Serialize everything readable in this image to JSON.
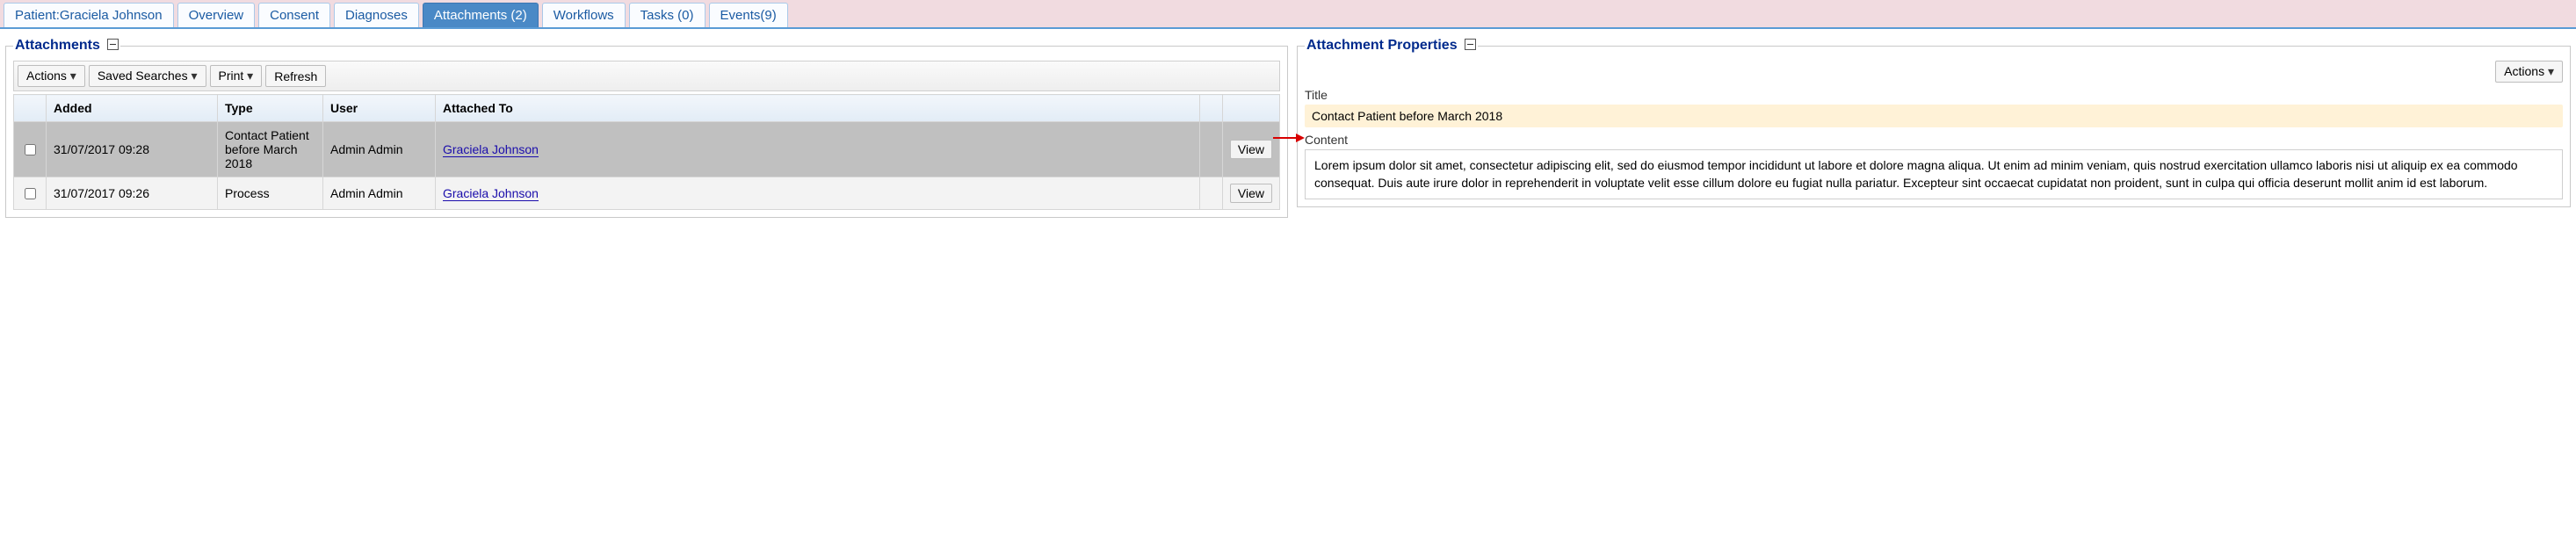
{
  "tabs": [
    {
      "label": "Patient:Graciela Johnson",
      "active": false
    },
    {
      "label": "Overview",
      "active": false
    },
    {
      "label": "Consent",
      "active": false
    },
    {
      "label": "Diagnoses",
      "active": false
    },
    {
      "label": "Attachments (2)",
      "active": true
    },
    {
      "label": "Workflows",
      "active": false
    },
    {
      "label": "Tasks (0)",
      "active": false
    },
    {
      "label": "Events(9)",
      "active": false
    }
  ],
  "attachments_panel": {
    "legend": "Attachments",
    "toolbar": {
      "actions": "Actions",
      "saved_searches": "Saved Searches",
      "print": "Print",
      "refresh": "Refresh"
    },
    "columns": {
      "added": "Added",
      "type": "Type",
      "user": "User",
      "attached_to": "Attached To"
    },
    "rows": [
      {
        "selected": true,
        "added": "31/07/2017 09:28",
        "type": "Contact Patient before March 2018",
        "user": "Admin Admin",
        "attached_to": "Graciela Johnson",
        "view": "View"
      },
      {
        "selected": false,
        "added": "31/07/2017 09:26",
        "type": "Process",
        "user": "Admin Admin",
        "attached_to": "Graciela Johnson",
        "view": "View"
      }
    ]
  },
  "properties_panel": {
    "legend": "Attachment Properties",
    "actions_btn": "Actions",
    "title_label": "Title",
    "title_value": "Contact Patient before March 2018",
    "content_label": "Content",
    "content_value": "Lorem ipsum dolor sit amet, consectetur adipiscing elit, sed do eiusmod tempor incididunt ut labore et dolore magna aliqua. Ut enim ad minim veniam, quis nostrud exercitation ullamco laboris nisi ut aliquip ex ea commodo consequat. Duis aute irure dolor in reprehenderit in voluptate velit esse cillum dolore eu fugiat nulla pariatur. Excepteur sint occaecat cupidatat non proident, sunt in culpa qui officia deserunt mollit anim id est laborum."
  }
}
